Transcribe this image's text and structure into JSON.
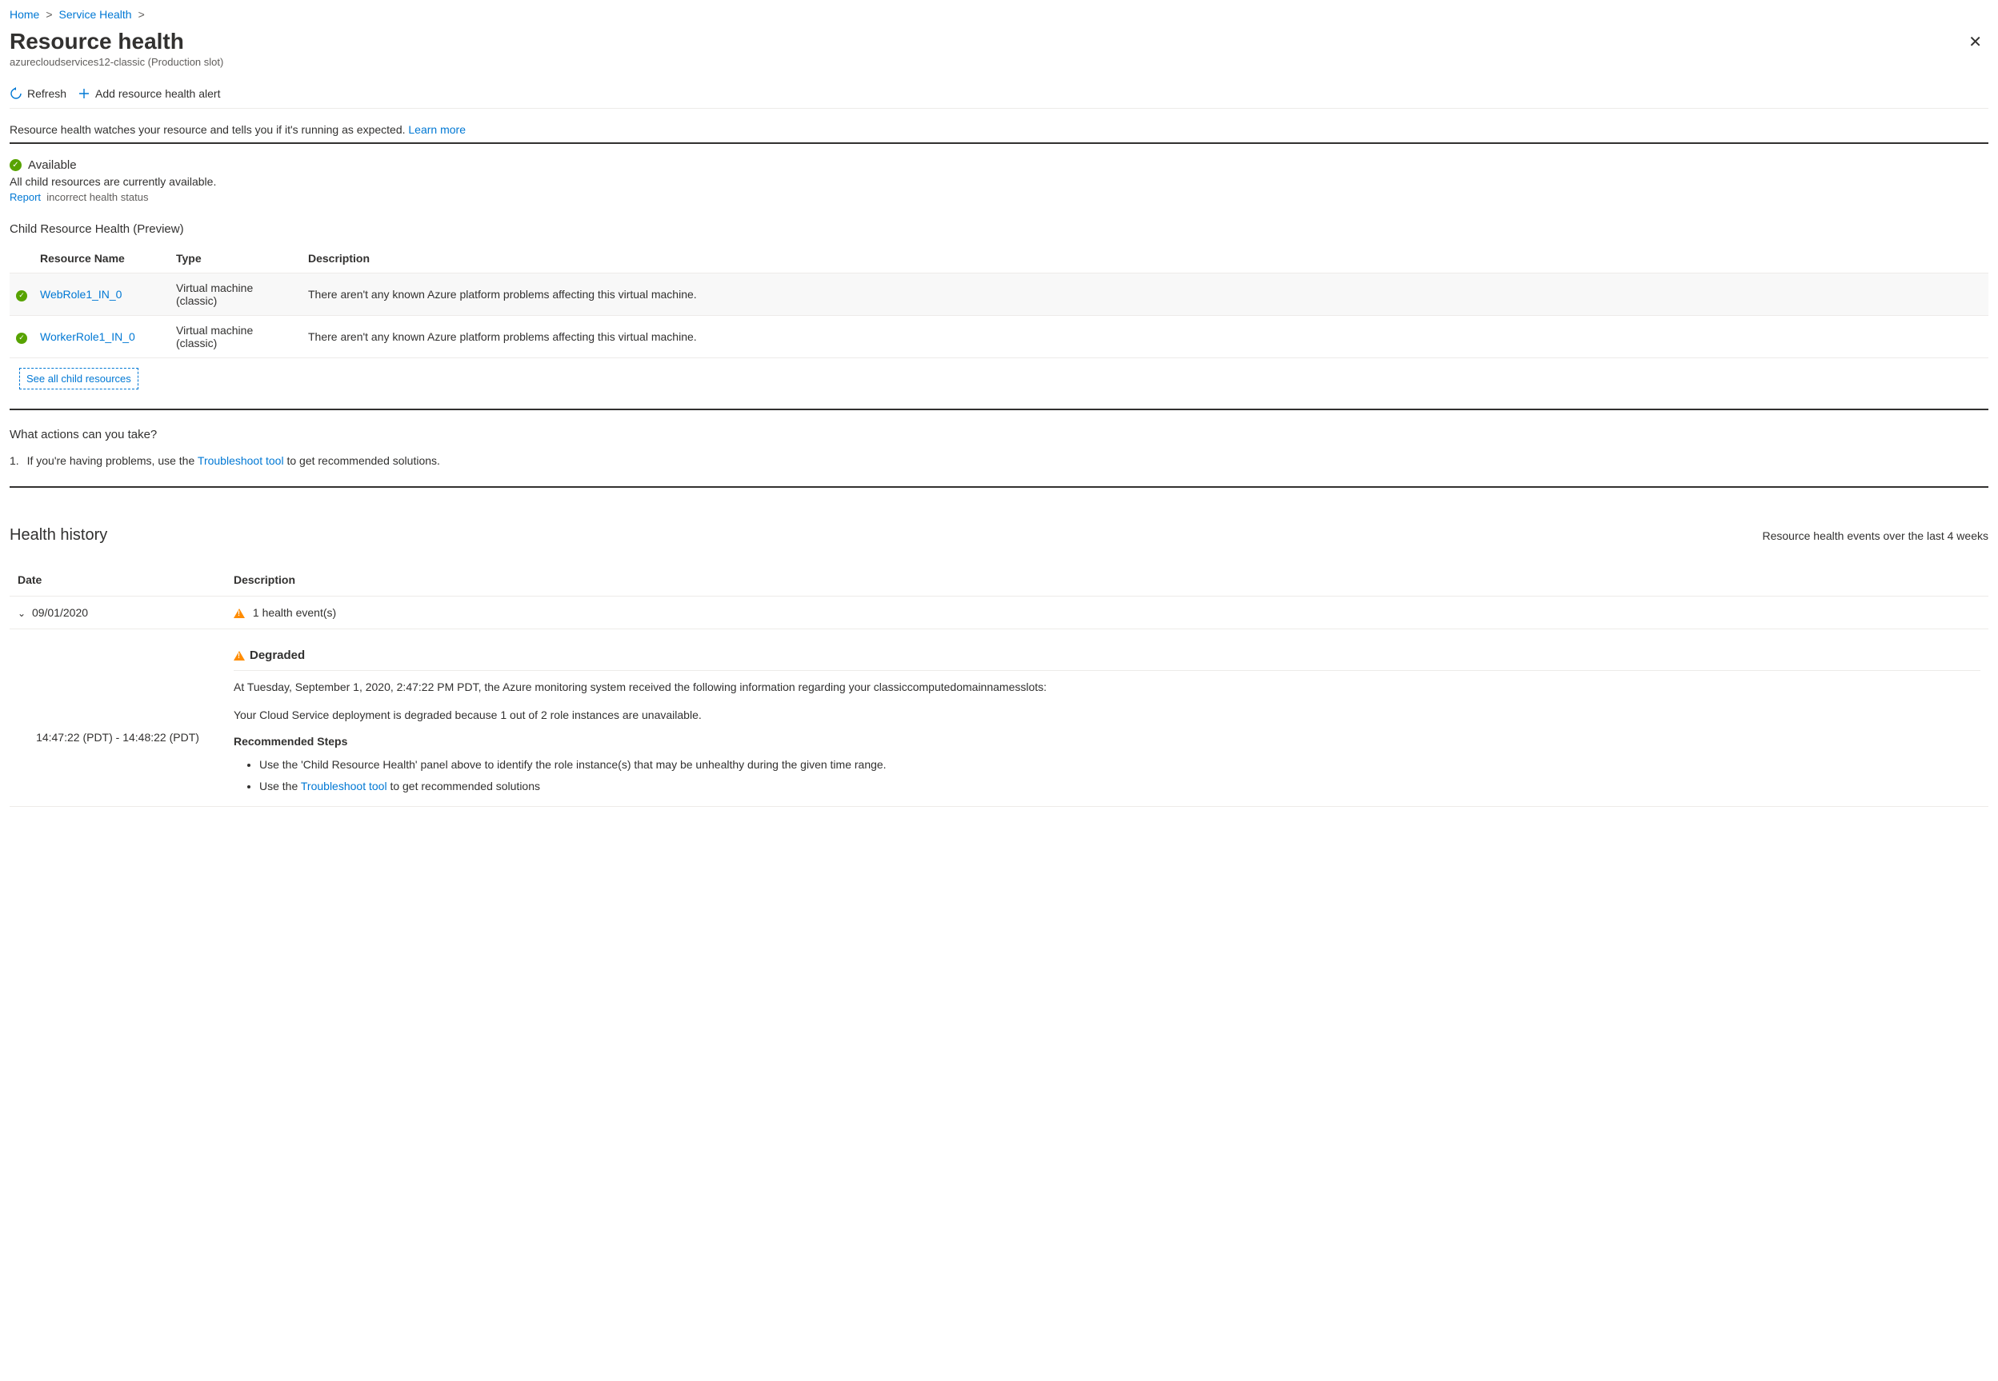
{
  "breadcrumb": {
    "home": "Home",
    "service_health": "Service Health"
  },
  "page": {
    "title": "Resource health",
    "subtitle": "azurecloudservices12-classic (Production slot)"
  },
  "toolbar": {
    "refresh_label": "Refresh",
    "add_alert_label": "Add resource health alert"
  },
  "intro": {
    "text": "Resource health watches your resource and tells you if it's running as expected. ",
    "link": "Learn more"
  },
  "status": {
    "label": "Available",
    "subtitle": "All child resources are currently available.",
    "report_link": "Report",
    "report_rest": "incorrect health status"
  },
  "child_health": {
    "heading": "Child Resource Health (Preview)",
    "cols": {
      "name": "Resource Name",
      "type": "Type",
      "desc": "Description"
    },
    "rows": [
      {
        "name": "WebRole1_IN_0",
        "type": "Virtual machine (classic)",
        "desc": "There aren't any known Azure platform problems affecting this virtual machine."
      },
      {
        "name": "WorkerRole1_IN_0",
        "type": "Virtual machine (classic)",
        "desc": "There aren't any known Azure platform problems affecting this virtual machine."
      }
    ],
    "see_all": "See all child resources"
  },
  "actions": {
    "heading": "What actions can you take?",
    "item_prefix": "If you're having problems, use the ",
    "item_link": "Troubleshoot tool",
    "item_suffix": " to get recommended solutions."
  },
  "history": {
    "heading": "Health history",
    "right_text": "Resource health events over the last 4 weeks",
    "cols": {
      "date": "Date",
      "desc": "Description"
    },
    "date_row": {
      "date": "09/01/2020",
      "summary": "1 health event(s)"
    },
    "detail": {
      "time_range": "14:47:22 (PDT) - 14:48:22 (PDT)",
      "title": "Degraded",
      "p1": "At Tuesday, September 1, 2020, 2:47:22 PM PDT, the Azure monitoring system received the following information regarding your classiccomputedomainnamesslots:",
      "p2": "Your Cloud Service deployment is degraded because 1 out of 2 role instances are unavailable.",
      "rec_title": "Recommended Steps",
      "step1": "Use the 'Child Resource Health' panel above to identify the role instance(s) that may be unhealthy during the given time range.",
      "step2_prefix": "Use the ",
      "step2_link": "Troubleshoot tool",
      "step2_suffix": " to get recommended solutions"
    }
  }
}
